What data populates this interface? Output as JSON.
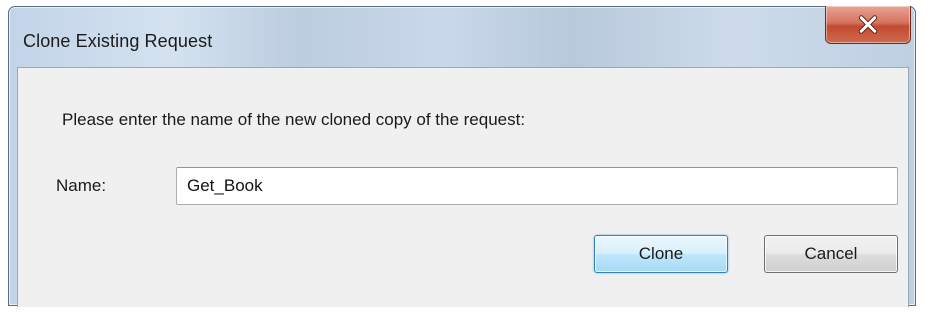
{
  "window": {
    "title": "Clone Existing Request",
    "close_symbol": "x"
  },
  "dialog": {
    "prompt": "Please enter the name of the new cloned copy of the request:",
    "name_label": "Name:",
    "name_value": "Get_Book"
  },
  "buttons": {
    "clone_label": "Clone",
    "cancel_label": "Cancel"
  },
  "icons": {
    "close": "close-icon"
  },
  "colors": {
    "close_button": "#c24a31",
    "default_button_border": "#3c7fb1",
    "client_background": "#f0f0f0"
  }
}
